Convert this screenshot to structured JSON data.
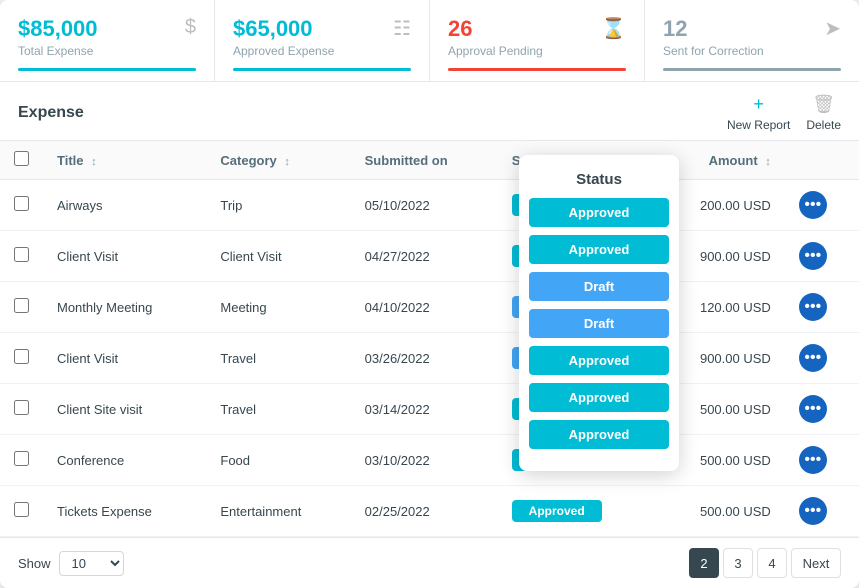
{
  "summary": {
    "totalExpense": {
      "value": "$85,000",
      "label": "Total Expense",
      "barColor": "cyan"
    },
    "approvedExpense": {
      "value": "$65,000",
      "label": "Approved Expense",
      "barColor": "cyan"
    },
    "approvalPending": {
      "value": "26",
      "label": "Approval Pending",
      "barColor": "red"
    },
    "sentForCorrection": {
      "value": "12",
      "label": "Sent for Correction",
      "barColor": "gray"
    }
  },
  "toolbar": {
    "title": "Expense",
    "newReportLabel": "New Report",
    "deleteLabel": "Delete"
  },
  "table": {
    "columns": [
      {
        "key": "checkbox",
        "label": ""
      },
      {
        "key": "title",
        "label": "Title"
      },
      {
        "key": "category",
        "label": "Category"
      },
      {
        "key": "submittedOn",
        "label": "Submitted on"
      },
      {
        "key": "status",
        "label": "Status"
      },
      {
        "key": "amount",
        "label": "Amount"
      },
      {
        "key": "actions",
        "label": ""
      }
    ],
    "rows": [
      {
        "title": "Airways",
        "category": "Trip",
        "submittedOn": "05/10/2022",
        "status": "Approved",
        "amount": "200.00 USD"
      },
      {
        "title": "Client Visit",
        "category": "Client Visit",
        "submittedOn": "04/27/2022",
        "status": "Approved",
        "amount": "900.00 USD"
      },
      {
        "title": "Monthly Meeting",
        "category": "Meeting",
        "submittedOn": "04/10/2022",
        "status": "Draft",
        "amount": "120.00 USD"
      },
      {
        "title": "Client Visit",
        "category": "Travel",
        "submittedOn": "03/26/2022",
        "status": "Draft",
        "amount": "900.00 USD"
      },
      {
        "title": "Client Site visit",
        "category": "Travel",
        "submittedOn": "03/14/2022",
        "status": "Approved",
        "amount": "500.00 USD"
      },
      {
        "title": "Conference",
        "category": "Food",
        "submittedOn": "03/10/2022",
        "status": "Approved",
        "amount": "500.00 USD"
      },
      {
        "title": "Tickets Expense",
        "category": "Entertainment",
        "submittedOn": "02/25/2022",
        "status": "Approved",
        "amount": "500.00 USD"
      }
    ]
  },
  "footer": {
    "showLabel": "Show",
    "showValue": "10",
    "pages": [
      "2",
      "3",
      "4"
    ],
    "activePage": "2",
    "nextLabel": "Next"
  },
  "statusDropdown": {
    "title": "Status",
    "options": [
      "Approved",
      "Draft"
    ]
  }
}
